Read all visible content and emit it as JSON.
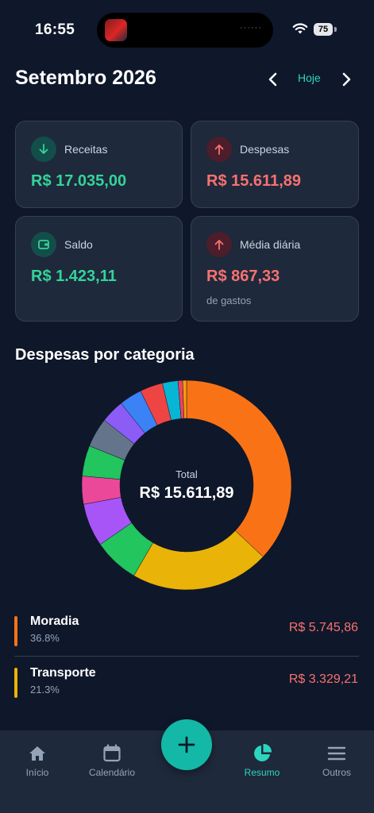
{
  "status_bar": {
    "time": "16:55",
    "battery": "75"
  },
  "header": {
    "title": "Setembro 2026",
    "today_label": "Hoje"
  },
  "cards": {
    "receitas": {
      "label": "Receitas",
      "value": "R$ 17.035,00"
    },
    "despesas": {
      "label": "Despesas",
      "value": "R$ 15.611,89"
    },
    "saldo": {
      "label": "Saldo",
      "value": "R$ 1.423,11"
    },
    "media": {
      "label": "Média diária",
      "value": "R$ 867,33",
      "sub": "de gastos"
    }
  },
  "section": {
    "title": "Despesas por categoria"
  },
  "donut": {
    "center_label": "Total",
    "center_value": "R$ 15.611,89"
  },
  "chart_data": {
    "type": "pie",
    "slices": [
      {
        "value": 36.8,
        "color": "#f97316"
      },
      {
        "value": 21.3,
        "color": "#eab308"
      },
      {
        "value": 7.0,
        "color": "#22c55e"
      },
      {
        "value": 6.6,
        "color": "#a855f7"
      },
      {
        "value": 4.3,
        "color": "#ec4899"
      },
      {
        "value": 4.7,
        "color": "#22c55e"
      },
      {
        "value": 4.5,
        "color": "#64748b"
      },
      {
        "value": 3.6,
        "color": "#8b5cf6"
      },
      {
        "value": 3.5,
        "color": "#3b82f6"
      },
      {
        "value": 3.5,
        "color": "#ef4444"
      },
      {
        "value": 2.4,
        "color": "#06b6d4"
      },
      {
        "value": 0.7,
        "color": "#f43f5e"
      },
      {
        "value": 0.6,
        "color": "#f59e0b"
      }
    ]
  },
  "categories": [
    {
      "name": "Moradia",
      "pct": "36.8%",
      "amount": "R$ 5.745,86",
      "color": "#f97316"
    },
    {
      "name": "Transporte",
      "pct": "21.3%",
      "amount": "R$ 3.329,21",
      "color": "#eab308"
    }
  ],
  "tabs": [
    {
      "label": "Início"
    },
    {
      "label": "Calendário"
    },
    {
      "label": "Resumo"
    },
    {
      "label": "Outros"
    }
  ],
  "colors": {
    "accent": "#2dd4bf",
    "income": "#34d399",
    "expense": "#f87171",
    "background": "#0f172a",
    "card": "#1e293b"
  }
}
